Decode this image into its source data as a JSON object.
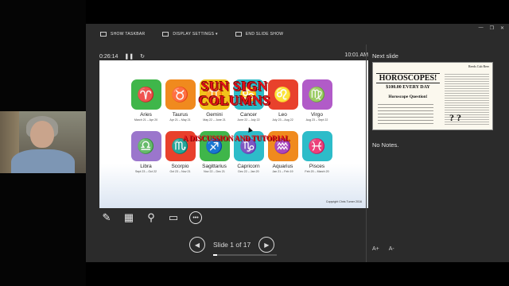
{
  "toolbar": {
    "show_taskbar": "SHOW TASKBAR",
    "display_settings": "DISPLAY SETTINGS ▾",
    "end_slide_show": "END SLIDE SHOW"
  },
  "window_controls": {
    "minimize": "—",
    "restore": "❐",
    "close": "✕"
  },
  "timer": {
    "elapsed": "0:26:14",
    "pause_icon": "pause-icon",
    "restart_icon": "restart-icon",
    "clock": "10:01 AM"
  },
  "slide": {
    "title": "SUN SIGN COLUMNS",
    "subtitle": "A DISCUSSION AND TUTORIAL",
    "copyright": "Copyright Chris Turner 2016",
    "signs": [
      {
        "name": "Aries",
        "dates": "March 21 – Apr 20",
        "symbol": "♈",
        "color": "#3fb64a"
      },
      {
        "name": "Taurus",
        "dates": "Apr 21 – May 21",
        "symbol": "♉",
        "color": "#f08a1e"
      },
      {
        "name": "Gemini",
        "dates": "May 22 – June 21",
        "symbol": "♊",
        "color": "#f2c21a"
      },
      {
        "name": "Cancer",
        "dates": "June 22 – July 22",
        "symbol": "♋",
        "color": "#2dbcc9"
      },
      {
        "name": "Leo",
        "dates": "July 23 – Aug 22",
        "symbol": "♌",
        "color": "#e8412c"
      },
      {
        "name": "Virgo",
        "dates": "Aug 23 – Sept 22",
        "symbol": "♍",
        "color": "#b15bc8"
      },
      {
        "name": "Libra",
        "dates": "Sept 23 – Oct 22",
        "symbol": "♎",
        "color": "#9b76cc"
      },
      {
        "name": "Scorpio",
        "dates": "Oct 23 – Nov 21",
        "symbol": "♏",
        "color": "#e8412c"
      },
      {
        "name": "Sagittarius",
        "dates": "Nov 22 – Dec 21",
        "symbol": "♐",
        "color": "#3fb64a"
      },
      {
        "name": "Capricorn",
        "dates": "Dec 22 – Jan 20",
        "symbol": "♑",
        "color": "#2dbcc9"
      },
      {
        "name": "Aquarius",
        "dates": "Jan 21 – Feb 19",
        "symbol": "♒",
        "color": "#f08a1e"
      },
      {
        "name": "Pisces",
        "dates": "Feb 20 – March 20",
        "symbol": "♓",
        "color": "#2dbcc9"
      }
    ]
  },
  "tools": [
    "pen-icon",
    "see-all-slides-icon",
    "zoom-icon",
    "screen-icon",
    "more-options-icon"
  ],
  "nav": {
    "prev": "◀",
    "label": "Slide 1 of 17",
    "next": "▶",
    "progress": 0.06
  },
  "next_slide": {
    "label": "Next slide",
    "header": "Reeds Cub Reer",
    "title": "HOROSCOPES!",
    "amount": "$100.00 EVERY DAY",
    "question": "Horoscope Question!",
    "marks": "? ?"
  },
  "notes": "No Notes.",
  "font_controls": {
    "increase": "A+",
    "decrease": "A-"
  }
}
